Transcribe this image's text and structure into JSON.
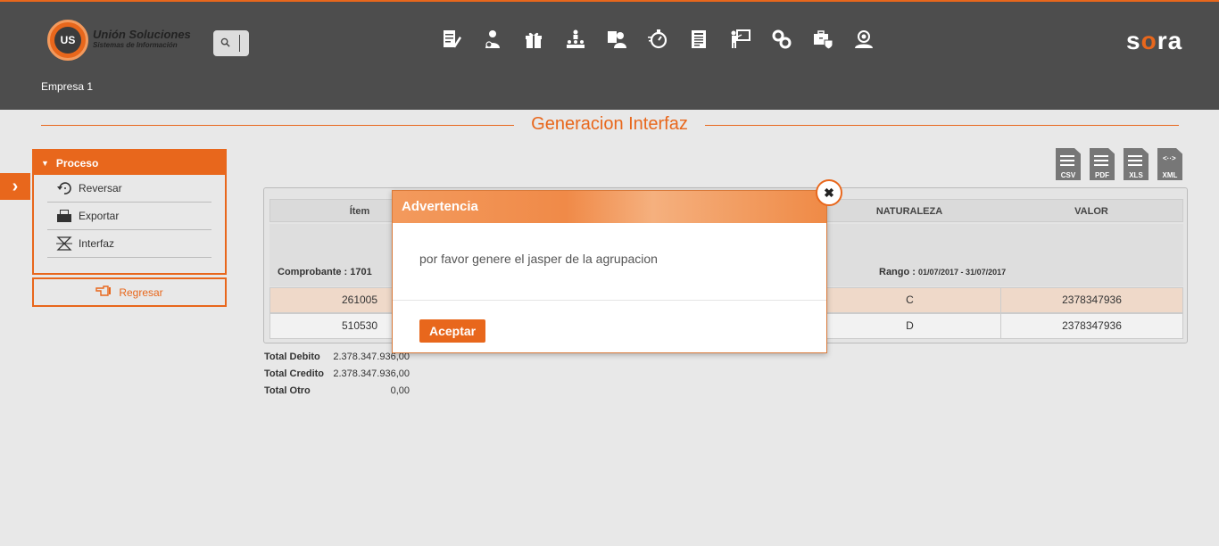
{
  "header": {
    "logo": {
      "badge": "US",
      "title": "Unión Soluciones",
      "subtitle": "Sistemas de Información"
    },
    "search_icon": "search-icon",
    "nav_icons": [
      "edit-document-icon",
      "user-money-icon",
      "gift-icon",
      "organization-icon",
      "user-card-icon",
      "stopwatch-icon",
      "report-icon",
      "presentation-icon",
      "gears-icon",
      "medical-briefcase-icon",
      "user-search-icon"
    ],
    "brand": "sora",
    "company": "Empresa 1",
    "accent": "#e8671c",
    "bg": "#4d4d4d"
  },
  "page": {
    "title": "Generacion Interfaz"
  },
  "sidebar": {
    "panel_title": "Proceso",
    "items": [
      {
        "label": "Reversar",
        "icon": "undo-icon"
      },
      {
        "label": "Exportar",
        "icon": "export-icon"
      },
      {
        "label": "Interfaz",
        "icon": "interface-icon"
      }
    ],
    "back_label": "Regresar"
  },
  "exports": [
    "CSV",
    "PDF",
    "XLS",
    "XML"
  ],
  "table": {
    "columns": [
      "Ítem",
      "NATURALEZA",
      "VALOR"
    ],
    "group": {
      "label": "Comprobante : 1701",
      "range_label": "Rango :",
      "range_value": "01/07/2017 - 31/07/2017"
    },
    "rows": [
      {
        "item": "261005",
        "naturaleza": "C",
        "valor": "2378347936"
      },
      {
        "item": "510530",
        "naturaleza": "D",
        "valor": "2378347936"
      }
    ]
  },
  "totals": [
    {
      "label": "Total Debito",
      "value": "2.378.347.936,00"
    },
    {
      "label": "Total Credito",
      "value": "2.378.347.936,00"
    },
    {
      "label": "Total Otro",
      "value": "0,00"
    }
  ],
  "modal": {
    "title": "Advertencia",
    "message": "por favor genere el jasper de la agrupacion",
    "accept_label": "Aceptar",
    "close_icon": "close-icon"
  }
}
